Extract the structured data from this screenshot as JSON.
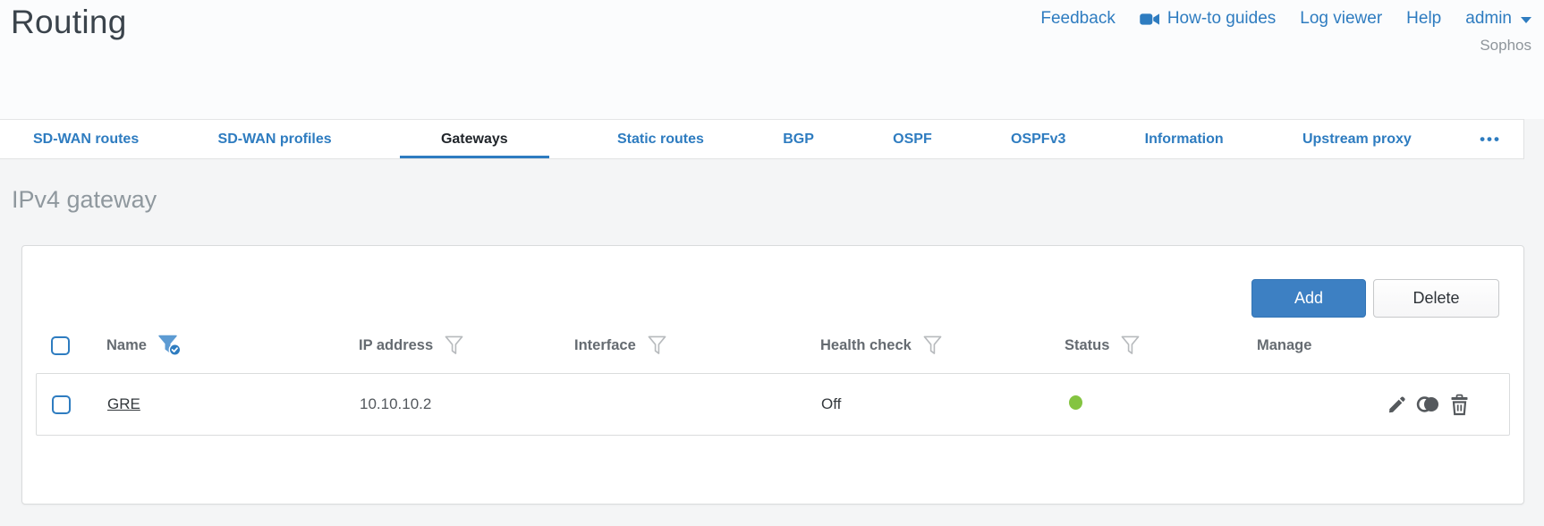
{
  "header": {
    "title": "Routing",
    "nav": {
      "feedback": "Feedback",
      "howto": "How-to guides",
      "log_viewer": "Log viewer",
      "help": "Help",
      "user": "admin"
    },
    "brand": "Sophos"
  },
  "tabs": {
    "items": [
      {
        "label": "SD-WAN routes",
        "active": false
      },
      {
        "label": "SD-WAN profiles",
        "active": false
      },
      {
        "label": "Gateways",
        "active": true
      },
      {
        "label": "Static routes",
        "active": false
      },
      {
        "label": "BGP",
        "active": false
      },
      {
        "label": "OSPF",
        "active": false
      },
      {
        "label": "OSPFv3",
        "active": false
      },
      {
        "label": "Information",
        "active": false
      },
      {
        "label": "Upstream proxy",
        "active": false
      }
    ],
    "more_label": "•••"
  },
  "main": {
    "section_title": "IPv4 gateway",
    "toolbar": {
      "add_label": "Add",
      "delete_label": "Delete"
    },
    "table": {
      "columns": [
        {
          "label": "Name",
          "filter": "active"
        },
        {
          "label": "IP address",
          "filter": "inactive"
        },
        {
          "label": "Interface",
          "filter": "inactive"
        },
        {
          "label": "Health check",
          "filter": "inactive"
        },
        {
          "label": "Status",
          "filter": "inactive"
        },
        {
          "label": "Manage",
          "filter": "none"
        }
      ],
      "rows": [
        {
          "name": "GRE",
          "ip_address": "10.10.10.2",
          "interface": "",
          "health_check": "Off",
          "status": "up",
          "manage_icons": [
            "edit",
            "clone",
            "delete"
          ]
        }
      ]
    }
  },
  "colors": {
    "accent_blue": "#2e7cc0",
    "add_button_blue": "#3d80c3",
    "status_green": "#84c441",
    "page_background": "#f4f5f6"
  }
}
